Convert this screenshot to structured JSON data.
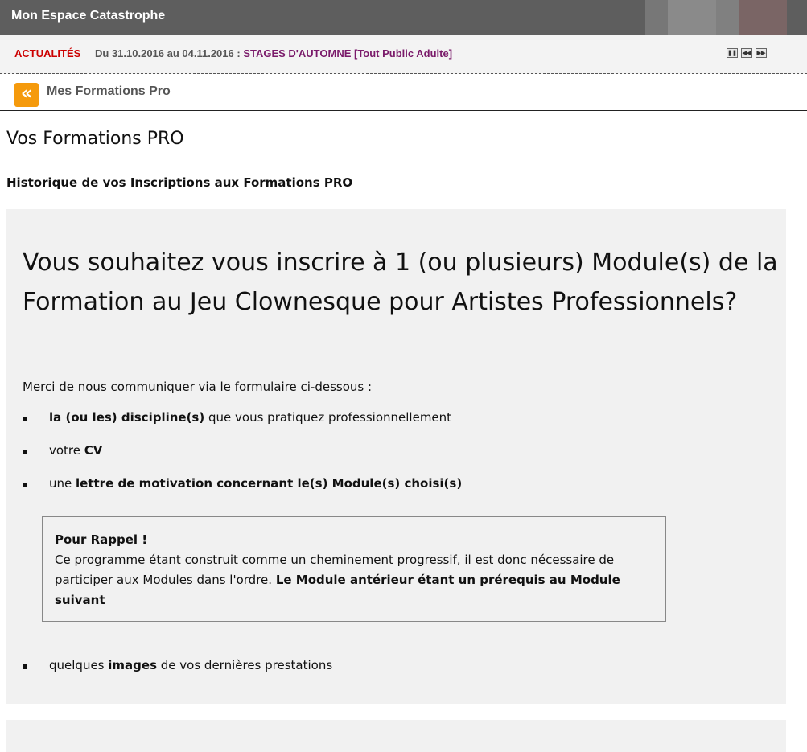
{
  "header": {
    "title": "Mon Espace Catastrophe",
    "colors": [
      "#777777",
      "#8a8a8a",
      "#808080",
      "#7a6565"
    ]
  },
  "ticker": {
    "label": "ACTUALITÉS",
    "dates": "Du 31.10.2016 au 04.11.2016 :",
    "event": "STAGES D'AUTOMNE [Tout Public Adulte]",
    "controls": {
      "pause": "pause-icon",
      "prev": "rewind-icon",
      "next": "fast-forward-icon"
    }
  },
  "breadcrumb": {
    "back_icon": "double-chevron-left-icon",
    "label": "Mes Formations Pro"
  },
  "page": {
    "title": "Vos Formations PRO",
    "subtitle": "Historique de vos Inscriptions aux Formations PRO"
  },
  "panel": {
    "heading": "Vous souhaitez vous inscrire à 1 (ou plusieurs) Module(s) de la Formation au Jeu Clownesque pour Artistes Professionnels?",
    "intro": "Merci de nous communiquer via le formulaire ci-dessous :",
    "items": [
      {
        "bold": "la (ou les) discipline(s)",
        "rest": " que vous pratiquez professionnellement"
      },
      {
        "pre": "votre ",
        "bold": "CV"
      },
      {
        "pre": "une ",
        "bold": "lettre de motivation concernant le(s) Module(s) choisi(s)"
      }
    ],
    "note": {
      "title": "Pour Rappel !",
      "text": "Ce programme étant construit comme un cheminement progressif, il est donc nécessaire de participer aux Modules dans l'ordre. ",
      "bold": "Le Module antérieur étant un prérequis au Module suivant"
    },
    "last_item": {
      "pre": "quelques ",
      "bold": "images",
      "rest": " de vos dernières prestations"
    }
  }
}
